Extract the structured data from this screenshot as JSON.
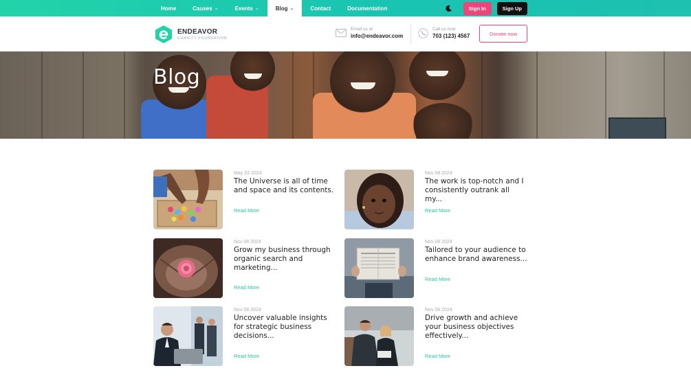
{
  "nav": {
    "items": [
      {
        "label": "Home",
        "has_dropdown": false,
        "active": false
      },
      {
        "label": "Causes",
        "has_dropdown": true,
        "active": false
      },
      {
        "label": "Events",
        "has_dropdown": true,
        "active": false
      },
      {
        "label": "Blog",
        "has_dropdown": true,
        "active": true
      },
      {
        "label": "Contact",
        "has_dropdown": false,
        "active": false
      },
      {
        "label": "Documentation",
        "has_dropdown": false,
        "active": false
      }
    ],
    "theme_icon": "moon-icon",
    "signin_label": "Sign In",
    "signup_label": "Sign Up"
  },
  "header": {
    "brand": "ENDEAVOR",
    "tagline": "CHARITY FOUNDATION",
    "email_label": "Email us at",
    "email_value": "info@endeavor.com",
    "phone_label": "Call us now",
    "phone_value": "703 (123) 4567",
    "donate_label": "Donate now"
  },
  "hero": {
    "title": "Blog"
  },
  "posts": [
    {
      "date": "May 23 2024",
      "title": "The Universe is all of time and space and its contents.",
      "read_more": "Read More"
    },
    {
      "date": "Nov 08 2024",
      "title": "The work is top-notch and I consistently outrank all my...",
      "read_more": "Read More"
    },
    {
      "date": "Nov 08 2024",
      "title": "Grow my business through organic search and marketing...",
      "read_more": "Read More"
    },
    {
      "date": "Nov 08 2024",
      "title": "Tailored to your audience to enhance brand awareness...",
      "read_more": "Read More"
    },
    {
      "date": "Nov 08 2024",
      "title": "Uncover valuable insights for strategic business decisions...",
      "read_more": "Read More"
    },
    {
      "date": "Nov 08 2024",
      "title": "Drive growth and achieve your business objectives effectively...",
      "read_more": "Read More"
    }
  ],
  "colors": {
    "accent": "#22c99c",
    "pink": "#f0457a",
    "dark": "#111111"
  }
}
